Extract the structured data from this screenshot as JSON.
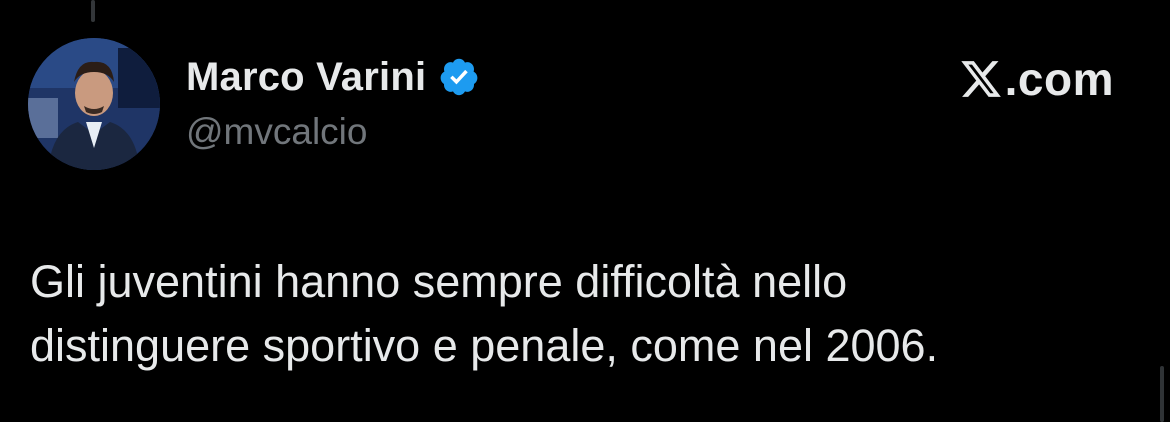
{
  "author": {
    "display_name": "Marco Varini",
    "handle": "@mvcalcio",
    "verified": true,
    "avatar_icon": "profile-photo"
  },
  "brand": {
    "text": ".com",
    "logo_icon": "x-logo-icon"
  },
  "tweet": {
    "text": "Gli juventini hanno sempre difficoltà nello\ndistinguere sportivo e penale, come nel 2006."
  },
  "colors": {
    "background": "#000000",
    "primary_text": "#e7e9ea",
    "secondary_text": "#71767b",
    "verified_blue": "#1d9bf0"
  }
}
